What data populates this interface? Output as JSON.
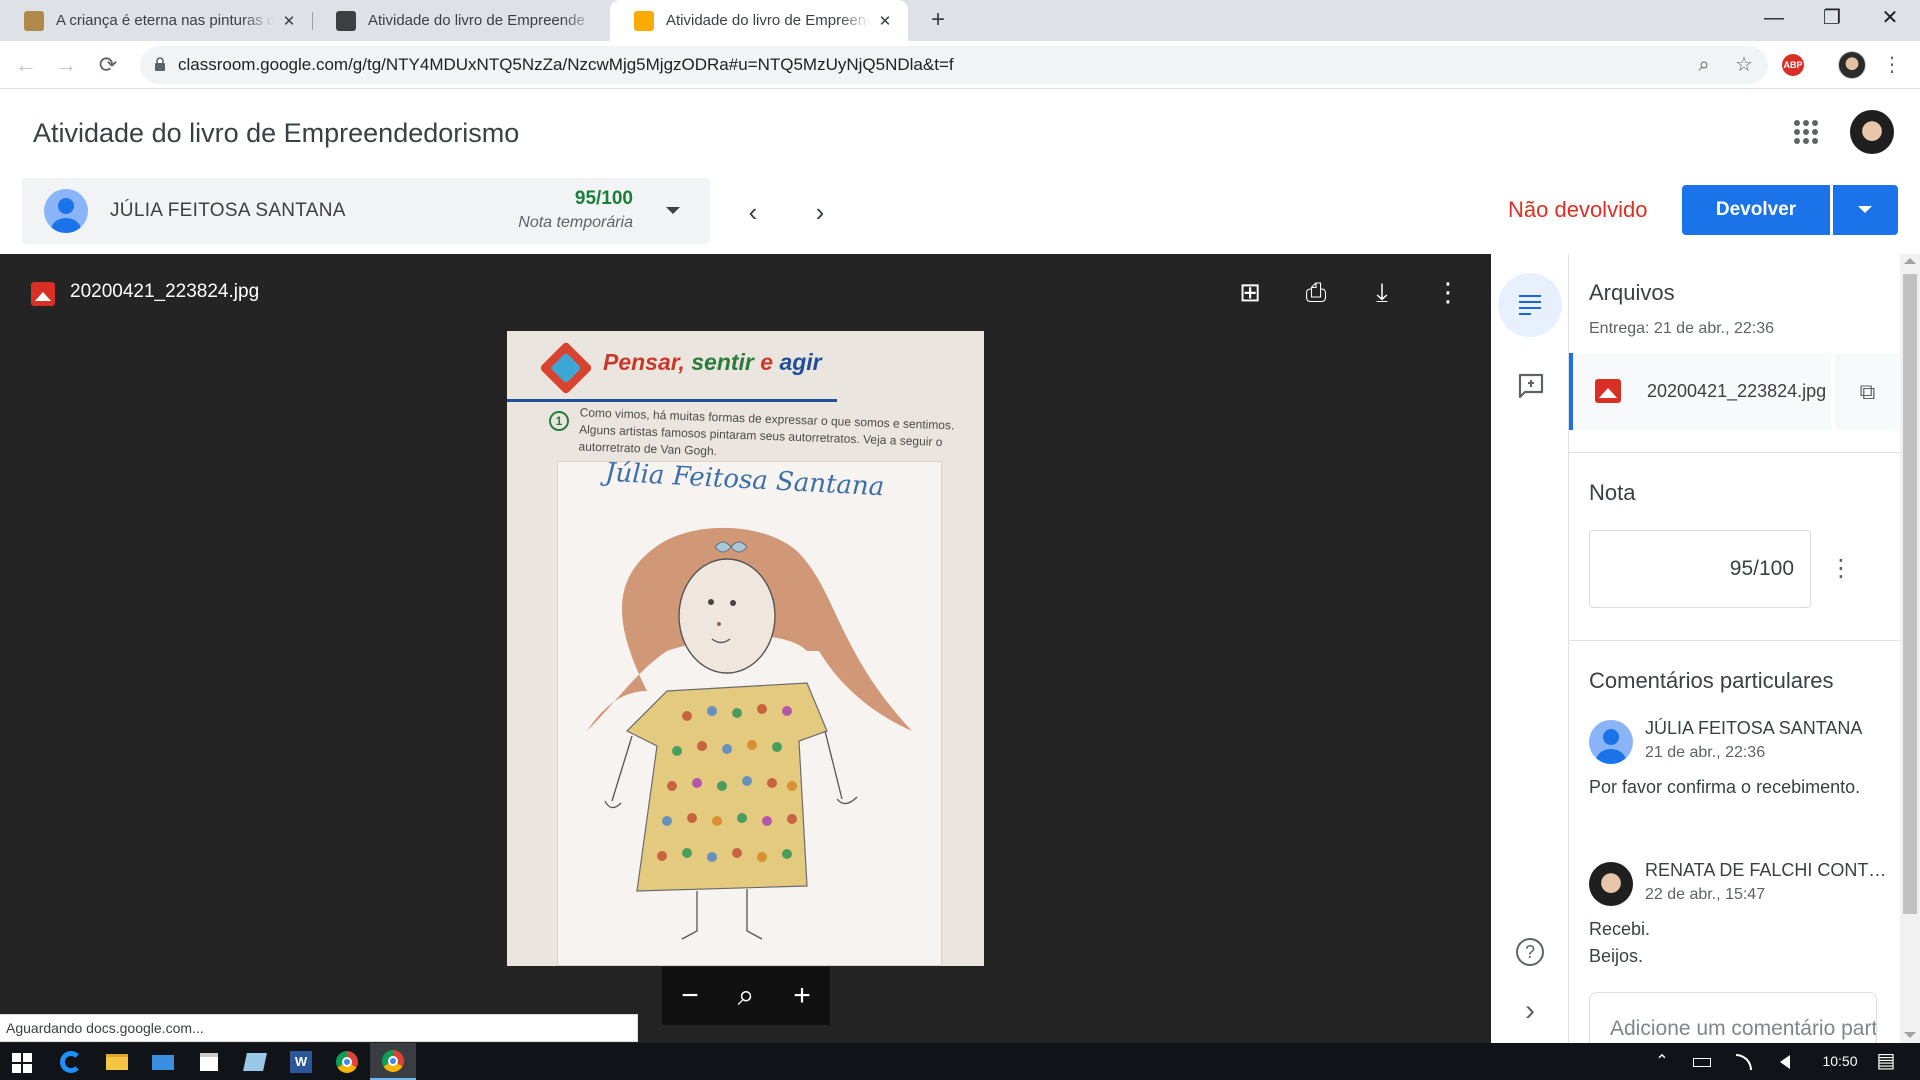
{
  "browser": {
    "tabs": [
      {
        "title": "A criança é eterna nas pinturas de",
        "favicon_color": "#b08a4a",
        "active": false
      },
      {
        "title": "Atividade do livro de Empreende",
        "favicon_color": "#3c4043",
        "active": false
      },
      {
        "title": "Atividade do livro de Empreende",
        "favicon_color": "#f9ab00",
        "active": true
      }
    ],
    "close_glyph": "✕",
    "new_tab_glyph": "+",
    "window_controls": {
      "minimize": "—",
      "maximize": "❐",
      "close": "✕"
    },
    "nav": {
      "back": "←",
      "forward": "→",
      "reload": "⟳"
    },
    "url": "classroom.google.com/g/tg/NTY4MDUxNTQ5NzZa/NzcwMjg5MjgzODRa#u=NTQ5MzUyNjQ5NDla&t=f",
    "omnibox_icons": {
      "zoom": "⌕",
      "bookmark": "☆"
    },
    "extension_label": "ABP",
    "menu_glyph": "⋮",
    "status_text": "Aguardando docs.google.com..."
  },
  "header": {
    "title": "Atividade do livro de Empreendedorismo",
    "student": {
      "name": "JÚLIA FEITOSA SANTANA",
      "grade": "95/100",
      "grade_note": "Nota temporária"
    },
    "prev_glyph": "‹",
    "next_glyph": "›",
    "status": "Não devolvido",
    "return_label": "Devolver",
    "colors": {
      "accent": "#1a73e8",
      "status": "#d93025",
      "grade": "#188038"
    }
  },
  "viewer": {
    "file_name": "20200421_223824.jpg",
    "icons": {
      "add_comment": "⊞",
      "print": "⎙",
      "download": "⤓",
      "more": "⋮"
    },
    "photo": {
      "heading_parts": [
        "Pensar",
        ", ",
        "sentir",
        " e ",
        "agir"
      ],
      "exercise_number": "1",
      "printed_text": "Como vimos, há muitas formas de expressar o que somos e sentimos. Alguns artistas famosos pintaram seus autorretratos. Veja a seguir o autorretrato de Van Gogh.",
      "handwritten_name": "Júlia Feitosa Santana"
    },
    "zoom": {
      "out": "−",
      "magnifier": "⌕",
      "in": "+"
    }
  },
  "rail": {
    "help": "?",
    "collapse": "›"
  },
  "panel": {
    "files_title": "Arquivos",
    "delivered": "Entrega: 21 de abr., 22:36",
    "file_name": "20200421_223824.jpg",
    "open_glyph": "⧉",
    "grade_title": "Nota",
    "grade_value": "95/100",
    "kebab_glyph": "⋮",
    "comments_title": "Comentários particulares",
    "comments": [
      {
        "author": "JÚLIA FEITOSA SANTANA",
        "date": "21 de abr., 22:36",
        "text": "Por favor confirma o recebimento."
      },
      {
        "author": "RENATA DE FALCHI CONTIERO",
        "date": "22 de abr., 15:47",
        "text": "Recebi.\nBeijos."
      }
    ],
    "comment_placeholder": "Adicione um comentário particular..."
  },
  "taskbar": {
    "tray": {
      "chevron": "⌃",
      "time": "10:50",
      "notifications": "▤"
    }
  }
}
